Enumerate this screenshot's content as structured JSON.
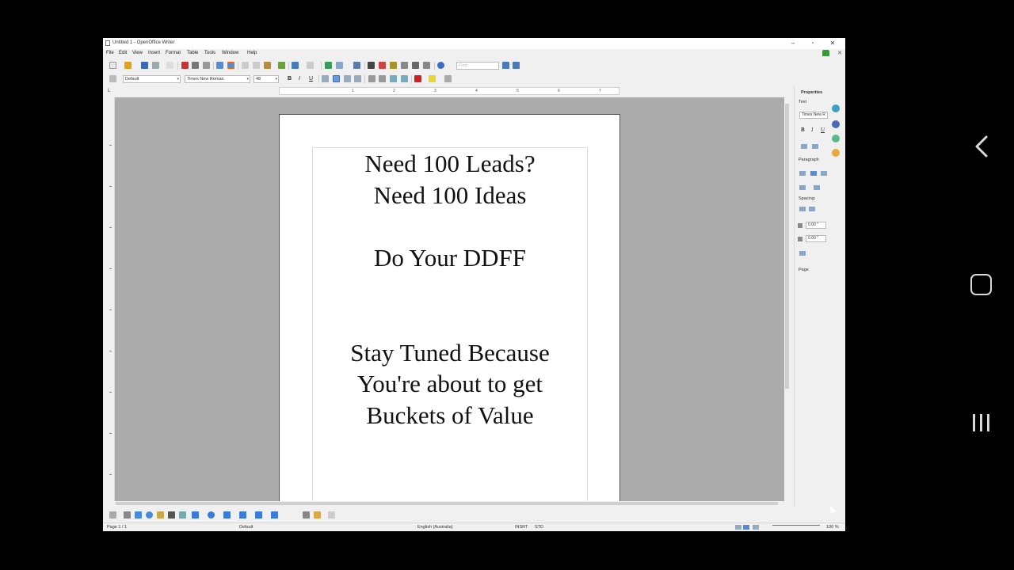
{
  "window": {
    "title": "Untitled 1 - OpenOffice Writer",
    "controls": {
      "minimize": "–",
      "maximize": "▫",
      "close": "✕"
    }
  },
  "menubar": {
    "items": [
      "File",
      "Edit",
      "View",
      "Insert",
      "Format",
      "Table",
      "Tools",
      "Window",
      "Help"
    ],
    "close_doc": "✕"
  },
  "toolbar": {
    "find_placeholder": "Find"
  },
  "formatting": {
    "paragraph_style": "Default",
    "font_name": "Times New Roman",
    "font_size": "48",
    "bold": "B",
    "italic": "I",
    "underline": "U"
  },
  "ruler": {
    "corner": "L",
    "numbers": [
      "1",
      "2",
      "3",
      "4",
      "5",
      "6",
      "7"
    ]
  },
  "document": {
    "lines": [
      "Need 100 Leads?",
      "Need 100 Ideas",
      "Do Your DDFF",
      "Stay Tuned Because",
      "You're about to get",
      "Buckets of Value"
    ]
  },
  "sidebar": {
    "title": "Properties",
    "text_section": "Text",
    "font_box": "Times New R",
    "paragraph_section": "Paragraph",
    "spacing_label": "Spacing:",
    "above_spacing": "0.00 \"",
    "below_spacing": "0.00 \"",
    "page_section": "Page",
    "bold": "B",
    "italic": "I",
    "underline": "U"
  },
  "statusbar": {
    "page": "Page 1 / 1",
    "style": "Default",
    "language": "English (Australia)",
    "insert_mode": "INSRT",
    "selection_mode": "STD",
    "zoom": "100 %"
  },
  "colors": {
    "doc_background": "#ababab",
    "page": "#ffffff",
    "window_chrome": "#f0f0f0"
  },
  "android_nav": {
    "back": "back-icon",
    "home": "home-icon",
    "recents": "recents-icon"
  }
}
